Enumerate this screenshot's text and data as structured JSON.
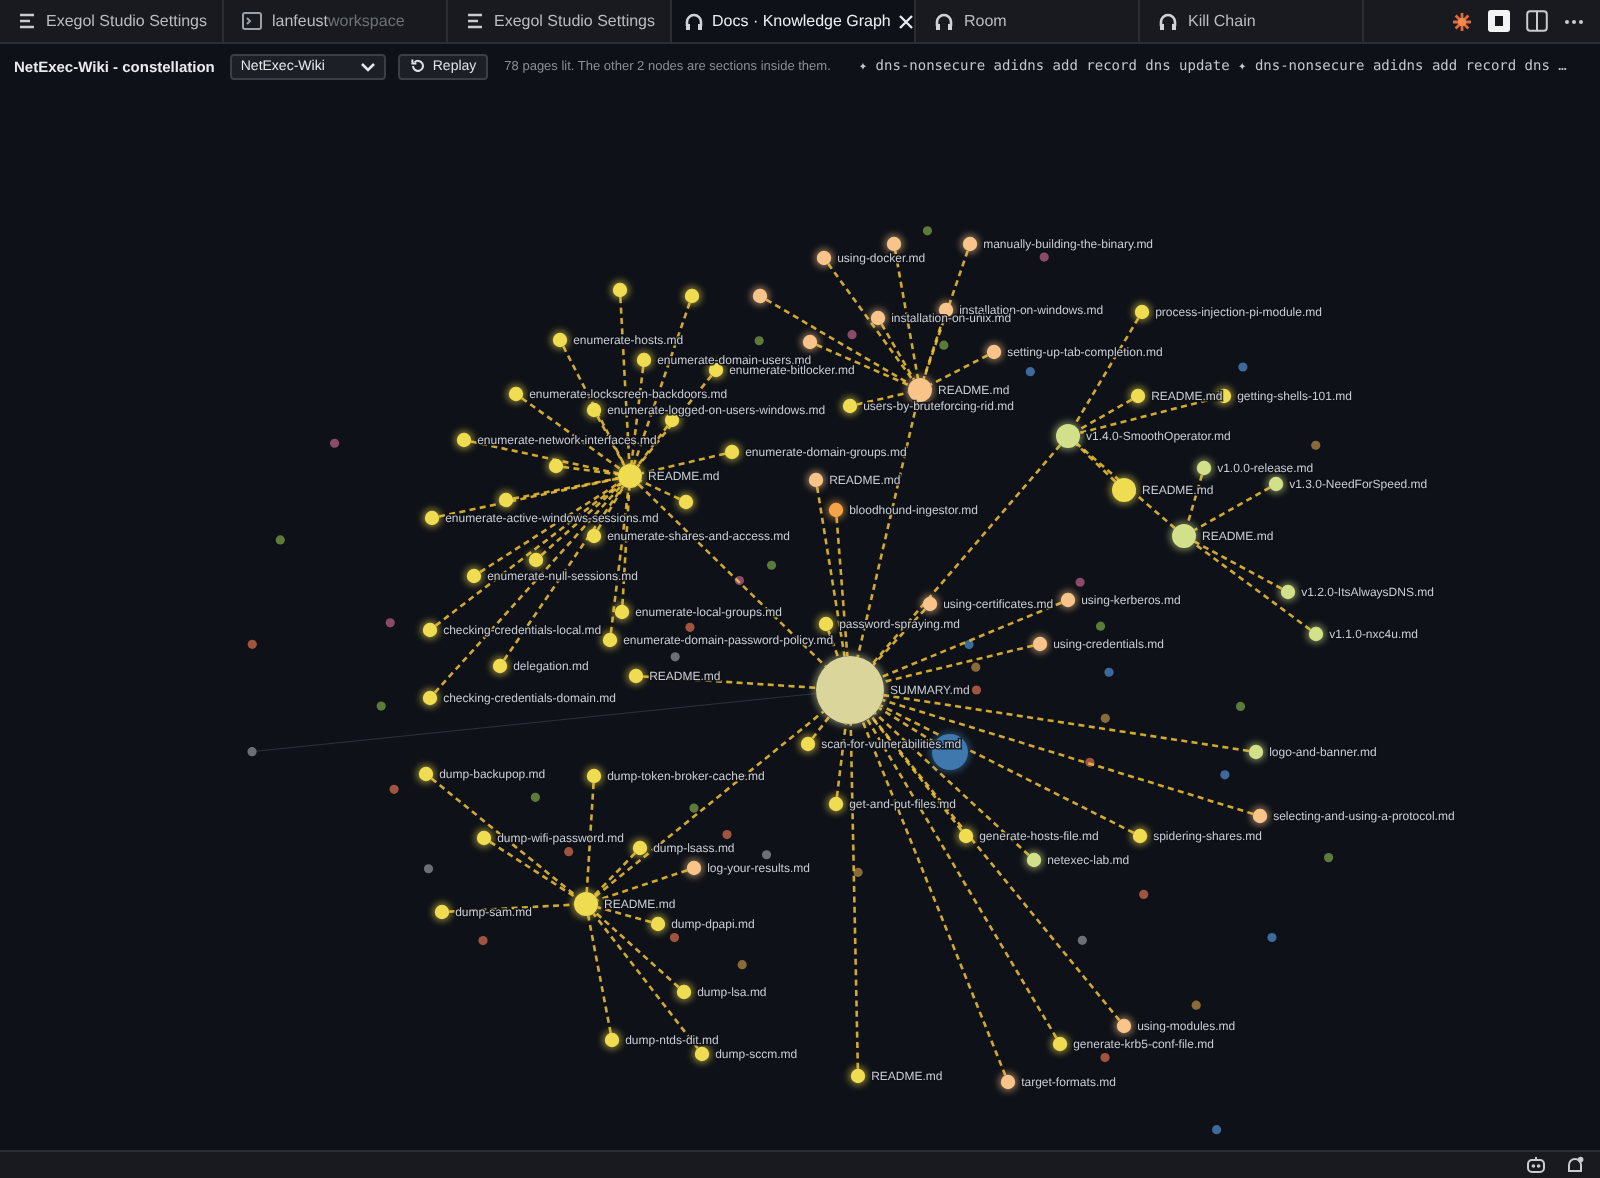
{
  "tabs": [
    {
      "kind": "settings",
      "label": "Exegol Studio Settings",
      "selected": false
    },
    {
      "kind": "terminal",
      "label": "lanfeust",
      "suffix": "workspace",
      "selected": false
    },
    {
      "kind": "settings",
      "label": "Exegol Studio Settings",
      "selected": false
    },
    {
      "kind": "graph",
      "label": "Docs · Knowledge Graph",
      "selected": true
    },
    {
      "kind": "graph",
      "label": "Room",
      "selected": false
    },
    {
      "kind": "graph",
      "label": "Kill Chain",
      "selected": false
    }
  ],
  "toolbar": {
    "title": "NetExec-Wiki - constellation",
    "select_value": "NetExec-Wiki",
    "replay_button": "Replay",
    "info": "78 pages lit. The other 2 nodes are sections inside them.",
    "ticker": "✦ dns-nonsecure adidns add record dns update ✦ dns-nonsecure adidns add record dns …"
  },
  "graph": {
    "nodes": [
      {
        "kind": "root",
        "label": "SUMMARY.md",
        "color": "#d9d59b"
      },
      {
        "kind": "hub",
        "label": "README.md",
        "color": "#f0dc50"
      },
      {
        "kind": "hub",
        "label": "README.md",
        "color": "#f0dc50"
      },
      {
        "kind": "hub",
        "label": "README.md",
        "color": "#f8c48a"
      },
      {
        "kind": "hub",
        "label": "v1.4.0-SmoothOperator.md",
        "color": "#d3e08a"
      },
      {
        "kind": "hub",
        "label": "README.md",
        "color": "#f0dc50"
      },
      {
        "kind": "hub",
        "label": "README.md",
        "color": "#d3e08a"
      },
      {
        "kind": "leaf",
        "label": "enumerate-hosts.md",
        "color": "#f0dc50"
      },
      {
        "kind": "leaf",
        "label": "enumerate-domain-users.md",
        "color": "#f0dc50"
      },
      {
        "kind": "leaf",
        "label": "enumerate-bitlocker.md",
        "color": "#f0dc50"
      },
      {
        "kind": "leaf",
        "label": "enumerate-lockscreen-backdoors.md",
        "color": "#f0dc50"
      },
      {
        "kind": "leaf",
        "label": "enumerate-logged-on-users-windows.md",
        "color": "#f0dc50"
      },
      {
        "kind": "leaf",
        "label": "enumerate-network-interfaces.md",
        "color": "#f0dc50"
      },
      {
        "kind": "leaf",
        "label": "enumerate-domain-groups.md",
        "color": "#f0dc50"
      },
      {
        "kind": "leaf",
        "label": "enumerate-active-windows-sessions.md",
        "color": "#f0dc50"
      },
      {
        "kind": "leaf",
        "label": "enumerate-shares-and-access.md",
        "color": "#f0dc50"
      },
      {
        "kind": "leaf",
        "label": "enumerate-null-sessions.md",
        "color": "#f0dc50"
      },
      {
        "kind": "leaf",
        "label": "enumerate-local-groups.md",
        "color": "#f0dc50"
      },
      {
        "kind": "leaf",
        "label": "checking-credentials-local.md",
        "color": "#f0dc50"
      },
      {
        "kind": "leaf",
        "label": "enumerate-domain-password-policy.md",
        "color": "#f0dc50"
      },
      {
        "kind": "leaf",
        "label": "delegation.md",
        "color": "#f0dc50"
      },
      {
        "kind": "leaf",
        "label": "checking-credentials-domain.md",
        "color": "#f0dc50"
      },
      {
        "kind": "leaf",
        "label": "README.md",
        "color": "#f0dc50"
      },
      {
        "kind": "leaf",
        "color": "#f0dc50"
      },
      {
        "kind": "leaf",
        "color": "#f0dc50"
      },
      {
        "kind": "leaf",
        "color": "#f0dc50"
      },
      {
        "kind": "leaf",
        "color": "#f0dc50"
      },
      {
        "kind": "leaf",
        "color": "#f0dc50"
      },
      {
        "kind": "leaf",
        "color": "#f0dc50"
      },
      {
        "kind": "leaf",
        "color": "#f0dc50"
      },
      {
        "kind": "leaf",
        "label": "using-docker.md",
        "color": "#f8c48a"
      },
      {
        "kind": "leaf",
        "color": "#f8c48a"
      },
      {
        "kind": "leaf",
        "label": "manually-building-the-binary.md",
        "color": "#f8c48a"
      },
      {
        "kind": "leaf",
        "label": "installation-on-windows.md",
        "color": "#f8c48a"
      },
      {
        "kind": "leaf",
        "label": "installation-on-unix.md",
        "color": "#f8c48a"
      },
      {
        "kind": "leaf",
        "color": "#f8c48a"
      },
      {
        "kind": "leaf",
        "label": "setting-up-tab-completion.md",
        "color": "#f8c48a"
      },
      {
        "kind": "leaf",
        "color": "#f8c48a"
      },
      {
        "kind": "leaf",
        "label": "users-by-bruteforcing-rid.md",
        "color": "#f0dc50"
      },
      {
        "kind": "leaf",
        "label": "README.md",
        "color": "#f8c48a"
      },
      {
        "kind": "leaf",
        "label": "bloodhound-ingestor.md",
        "color": "#f5a548"
      },
      {
        "kind": "leaf",
        "label": "process-injection-pi-module.md",
        "color": "#f0dc50"
      },
      {
        "kind": "leaf",
        "label": "README.md",
        "color": "#f0dc50"
      },
      {
        "kind": "leaf",
        "label": "getting-shells-101.md",
        "color": "#f0dc50"
      },
      {
        "kind": "leaf",
        "label": "v1.0.0-release.md",
        "color": "#d3e08a"
      },
      {
        "kind": "leaf",
        "label": "v1.3.0-NeedForSpeed.md",
        "color": "#d3e08a"
      },
      {
        "kind": "leaf",
        "label": "v1.2.0-ItsAlwaysDNS.md",
        "color": "#d3e08a"
      },
      {
        "kind": "leaf",
        "label": "v1.1.0-nxc4u.md",
        "color": "#d3e08a"
      },
      {
        "kind": "leaf",
        "label": "using-certificates.md",
        "color": "#f8c48a"
      },
      {
        "kind": "leaf",
        "label": "using-kerberos.md",
        "color": "#f8c48a"
      },
      {
        "kind": "leaf",
        "label": "using-credentials.md",
        "color": "#f8c48a"
      },
      {
        "kind": "leaf",
        "label": "password-spraying.md",
        "color": "#f0dc50"
      },
      {
        "kind": "leaf",
        "label": "scan-for-vulnerabilities.md",
        "color": "#f0dc50"
      },
      {
        "kind": "leaf",
        "label": "logo-and-banner.md",
        "color": "#d3e08a"
      },
      {
        "kind": "leaf",
        "label": "get-and-put-files.md",
        "color": "#f0dc50"
      },
      {
        "kind": "leaf",
        "label": "selecting-and-using-a-protocol.md",
        "color": "#f8c48a"
      },
      {
        "kind": "leaf",
        "label": "generate-hosts-file.md",
        "color": "#f0dc50"
      },
      {
        "kind": "leaf",
        "label": "spidering-shares.md",
        "color": "#f0dc50"
      },
      {
        "kind": "leaf",
        "label": "netexec-lab.md",
        "color": "#d3e08a"
      },
      {
        "kind": "leaf",
        "label": "using-modules.md",
        "color": "#f8c48a"
      },
      {
        "kind": "leaf",
        "label": "generate-krb5-conf-file.md",
        "color": "#f0dc50"
      },
      {
        "kind": "leaf",
        "label": "README.md",
        "color": "#f0dc50"
      },
      {
        "kind": "leaf",
        "label": "target-formats.md",
        "color": "#f8c48a"
      },
      {
        "kind": "leaf",
        "label": "dump-backupop.md",
        "color": "#f0dc50"
      },
      {
        "kind": "leaf",
        "label": "dump-token-broker-cache.md",
        "color": "#f0dc50"
      },
      {
        "kind": "leaf",
        "label": "dump-wifi-password.md",
        "color": "#f0dc50"
      },
      {
        "kind": "leaf",
        "label": "dump-lsass.md",
        "color": "#f0dc50"
      },
      {
        "kind": "leaf",
        "label": "log-your-results.md",
        "color": "#f8c48a"
      },
      {
        "kind": "leaf",
        "label": "dump-sam.md",
        "color": "#f0dc50"
      },
      {
        "kind": "leaf",
        "label": "dump-dpapi.md",
        "color": "#f0dc50"
      },
      {
        "kind": "leaf",
        "label": "dump-lsa.md",
        "color": "#f0dc50"
      },
      {
        "kind": "leaf",
        "label": "dump-ntds-dit.md",
        "color": "#f0dc50"
      },
      {
        "kind": "leaf",
        "label": "dump-sccm.md",
        "color": "#f0dc50"
      },
      {
        "kind": "section",
        "color": "#3f78ad"
      }
    ]
  }
}
